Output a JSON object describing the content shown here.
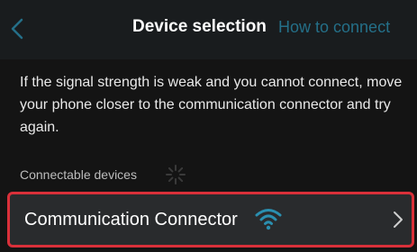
{
  "navbar": {
    "title": "Device selection",
    "link": "How to connect"
  },
  "message": "If the signal strength is weak and you cannot connect, move your phone closer to the communication connector and try again.",
  "section": {
    "label": "Connectable devices"
  },
  "devices": [
    {
      "name": "Communication Connector",
      "signal_icon": "wifi-icon"
    }
  ],
  "colors": {
    "accent": "#246f88",
    "selection_border": "#d9303a",
    "background": "#141414",
    "row_background": "#292b2d"
  }
}
